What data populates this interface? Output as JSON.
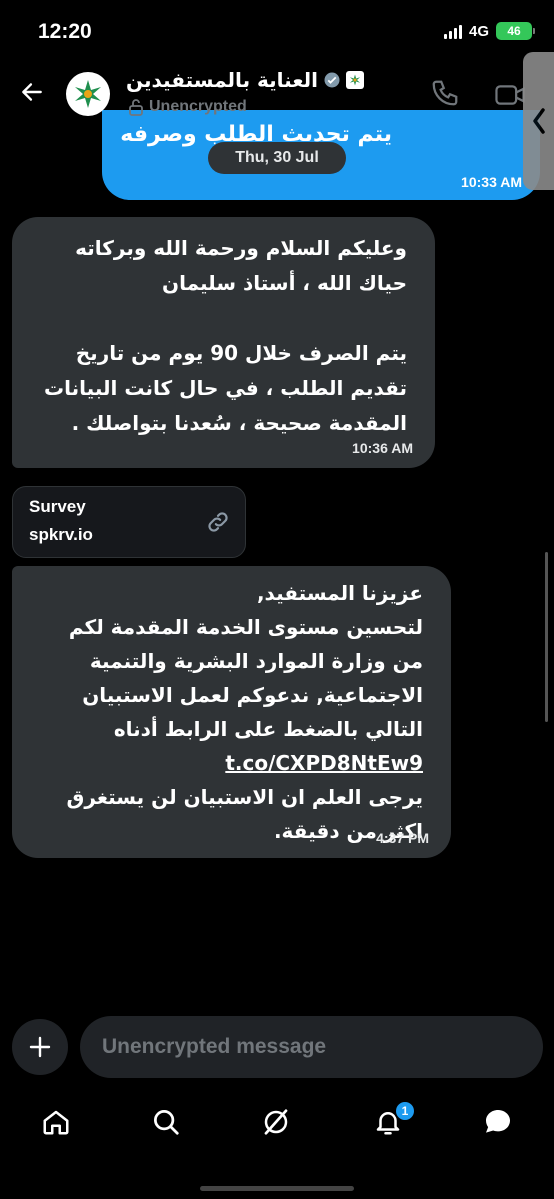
{
  "status_bar": {
    "time": "12:20",
    "network": "4G",
    "battery": "46"
  },
  "header": {
    "title": "العناية بالمستفيدين",
    "encryption_status": "Unencrypted"
  },
  "messages": {
    "sent_partial_text": "يتم تحديث الطلب وصرفه",
    "sent_time": "10:33 AM",
    "date_separator": "Thu, 30 Jul",
    "received_1": {
      "text": "وعليكم السلام ورحمة الله وبركاته\nحياك الله ، أستاذ سليمان\n\nيتم الصرف خلال 90 يوم من تاريخ\nتقديم الطلب ، في حال كانت البيانات\nالمقدمة صحيحة ، سُعدنا بتواصلك .",
      "time": "10:36 AM"
    },
    "link_card": {
      "title": "Survey",
      "domain": "spkrv.io"
    },
    "received_2": {
      "text_before": "عزيزنا المستفيد,\nلتحسين مستوى الخدمة المقدمة لكم\nمن وزارة الموارد البشرية والتنمية\nالاجتماعية, ندعوكم لعمل الاستبيان\nالتالي بالضغط على الرابط أدناه",
      "link": "t.co/CXPD8NtEw9",
      "text_after": "يرجى العلم ان الاستبيان لن يستغرق\nاكثر من دقيقة.",
      "time": "4:37 PM"
    }
  },
  "composer": {
    "placeholder": "Unencrypted message"
  },
  "nav": {
    "notifications_badge": "1"
  },
  "colors": {
    "accent": "#1d9bf0",
    "bubble_received": "#2f3336",
    "muted": "#71767b",
    "battery": "#34c759"
  }
}
